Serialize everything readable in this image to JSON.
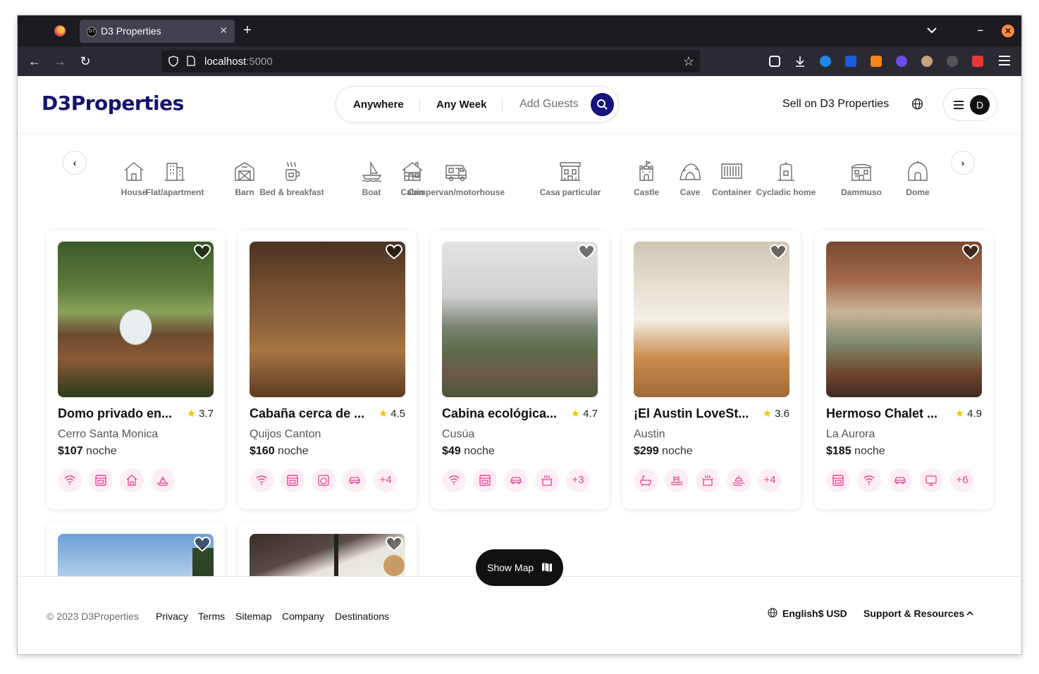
{
  "browser": {
    "tab_title": "D3 Properties",
    "tab_favicon_text": "D3",
    "url_host": "localhost",
    "url_port": ":5000"
  },
  "header": {
    "logo": "D3Properties",
    "search": {
      "where": "Anywhere",
      "when": "Any Week",
      "guests": "Add Guests"
    },
    "sell": "Sell on D3 Properties",
    "avatar_initial": "D"
  },
  "categories": [
    {
      "label": "House",
      "icon": "house-icon"
    },
    {
      "label": "Flat/apartment",
      "icon": "building-icon"
    },
    {
      "label": "Barn",
      "icon": "barn-icon"
    },
    {
      "label": "Bed & breakfast",
      "icon": "coffee-icon"
    },
    {
      "label": "Boat",
      "icon": "boat-icon"
    },
    {
      "label": "Cabin",
      "icon": "cabin-icon"
    },
    {
      "label": "Campervan/motorhouse",
      "icon": "campervan-icon"
    },
    {
      "label": "Casa particular",
      "icon": "casa-icon"
    },
    {
      "label": "Castle",
      "icon": "castle-icon"
    },
    {
      "label": "Cave",
      "icon": "cave-icon"
    },
    {
      "label": "Container",
      "icon": "container-icon"
    },
    {
      "label": "Cycladic home",
      "icon": "cycladic-icon"
    },
    {
      "label": "Dammuso",
      "icon": "dammuso-icon"
    },
    {
      "label": "Dome",
      "icon": "dome-icon"
    }
  ],
  "listings": [
    {
      "title": "Domo privado en...",
      "rating": "3.7",
      "location": "Cerro Santa Monica",
      "price": "$107",
      "unit": "noche",
      "amenities": [
        "wifi-icon",
        "oven-icon",
        "house-icon",
        "spa-icon"
      ],
      "more": ""
    },
    {
      "title": "Cabaña cerca de ...",
      "rating": "4.5",
      "location": "Quijos Canton",
      "price": "$160",
      "unit": "noche",
      "amenities": [
        "wifi-icon",
        "oven-icon",
        "washer-icon",
        "car-icon"
      ],
      "more": "+4"
    },
    {
      "title": "Cabina ecológica...",
      "rating": "4.7",
      "location": "Cusúa",
      "price": "$49",
      "unit": "noche",
      "amenities": [
        "wifi-icon",
        "oven-icon",
        "car-icon",
        "kitchen-icon"
      ],
      "more": "+3"
    },
    {
      "title": "¡El Austin LoveSt...",
      "rating": "3.6",
      "location": "Austin",
      "price": "$299",
      "unit": "noche",
      "amenities": [
        "bathtub-icon",
        "pool-icon",
        "kitchen-icon",
        "beach-icon"
      ],
      "more": "+4"
    },
    {
      "title": "Hermoso Chalet ...",
      "rating": "4.9",
      "location": "La Aurora",
      "price": "$185",
      "unit": "noche",
      "amenities": [
        "oven-icon",
        "wifi-icon",
        "car-icon",
        "tv-icon"
      ],
      "more": "+6"
    }
  ],
  "show_map": "Show Map",
  "footer": {
    "copyright": "© 2023 D3Properties",
    "links": [
      "Privacy",
      "Terms",
      "Sitemap",
      "Company",
      "Destinations"
    ],
    "language": "English",
    "currency": "$ USD",
    "support": "Support & Resources"
  },
  "colors": {
    "brand": "#14146f",
    "accent_pink": "#e8418f",
    "star": "#f5c400"
  }
}
